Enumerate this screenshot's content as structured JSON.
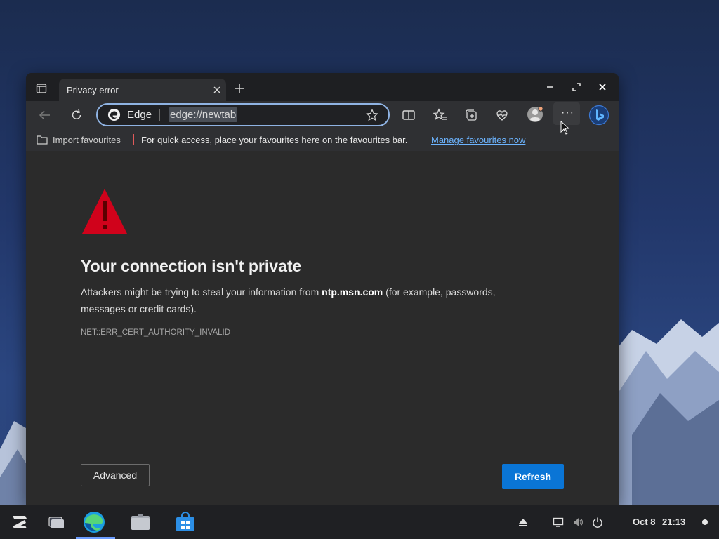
{
  "window": {
    "tab_title": "Privacy error"
  },
  "addressbar": {
    "site_label": "Edge",
    "url": "edge://newtab"
  },
  "favourites_bar": {
    "import_label": "Import favourites",
    "hint_text": "For quick access, place your favourites here on the favourites bar.",
    "manage_link": "Manage favourites now"
  },
  "error_page": {
    "title": "Your connection isn't private",
    "desc_prefix": "Attackers might be trying to steal your information from ",
    "desc_host": "ntp.msn.com",
    "desc_suffix": " (for example, passwords, messages or credit cards).",
    "error_code": "NET::ERR_CERT_AUTHORITY_INVALID",
    "advanced_label": "Advanced",
    "refresh_label": "Refresh"
  },
  "taskbar": {
    "apps": [
      "zorin-menu-icon",
      "workspaces-icon",
      "edge-browser-icon",
      "files-icon",
      "software-store-icon"
    ],
    "active_app": "edge-browser-icon",
    "date": "Oct 8",
    "time": "21:13"
  },
  "colors": {
    "accent_blue": "#0a75d6",
    "link_blue": "#6cb4ff",
    "warning_red": "#d0021b"
  }
}
